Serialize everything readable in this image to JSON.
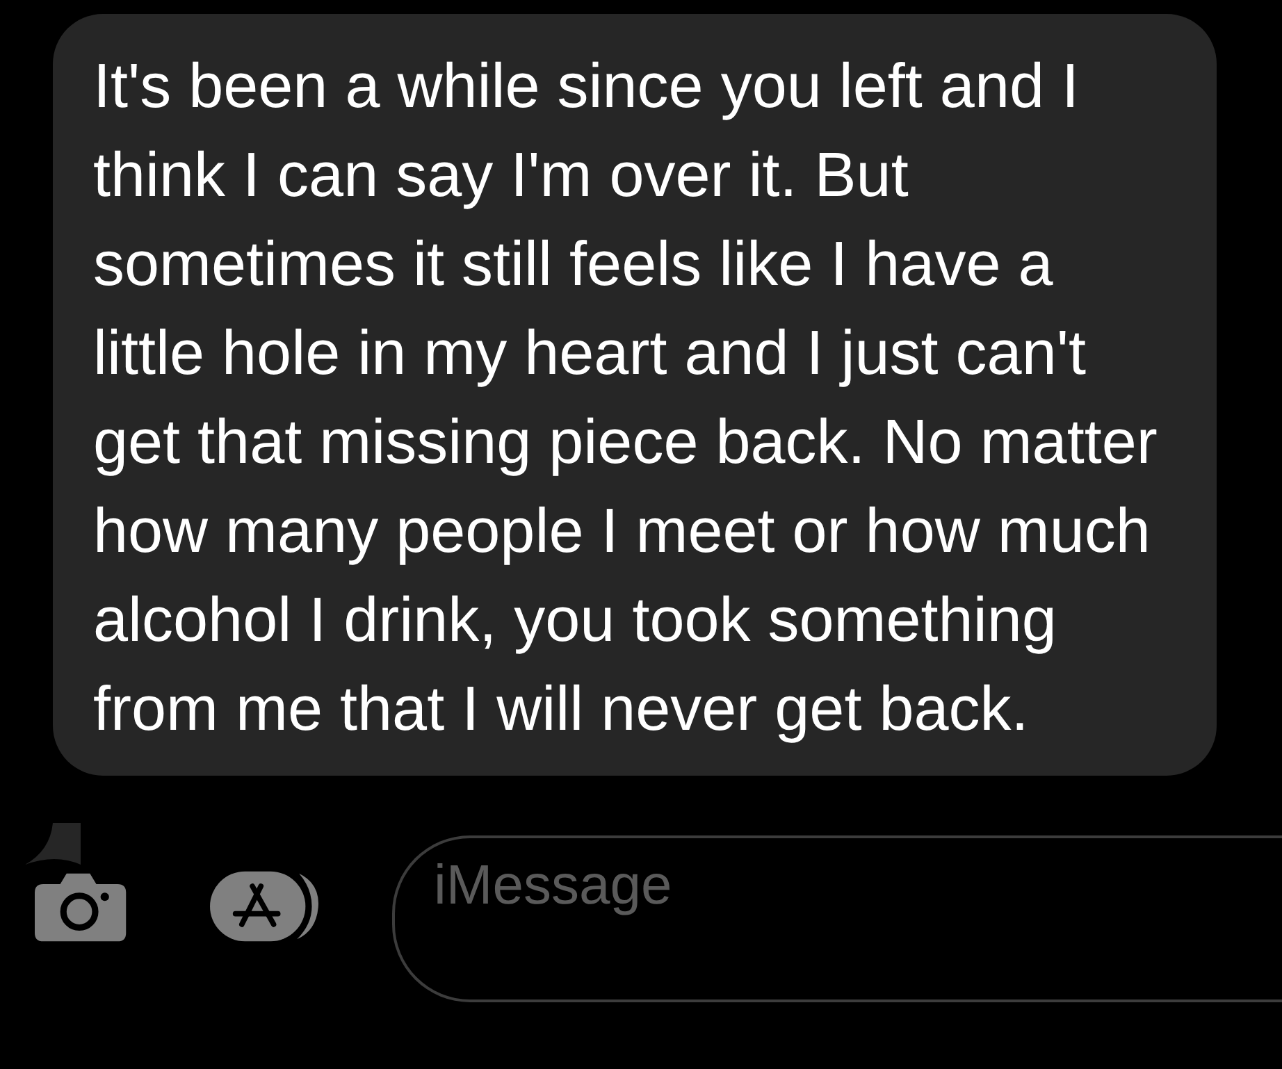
{
  "message": {
    "text": "It's been a while since you left and I think I can say I'm over it. But sometimes it still feels like I have a little hole in my heart and I just can't get that missing piece back. No matter how many people I meet or how much alcohol I drink, you took something from me that I will never get back."
  },
  "compose": {
    "placeholder": "iMessage"
  }
}
